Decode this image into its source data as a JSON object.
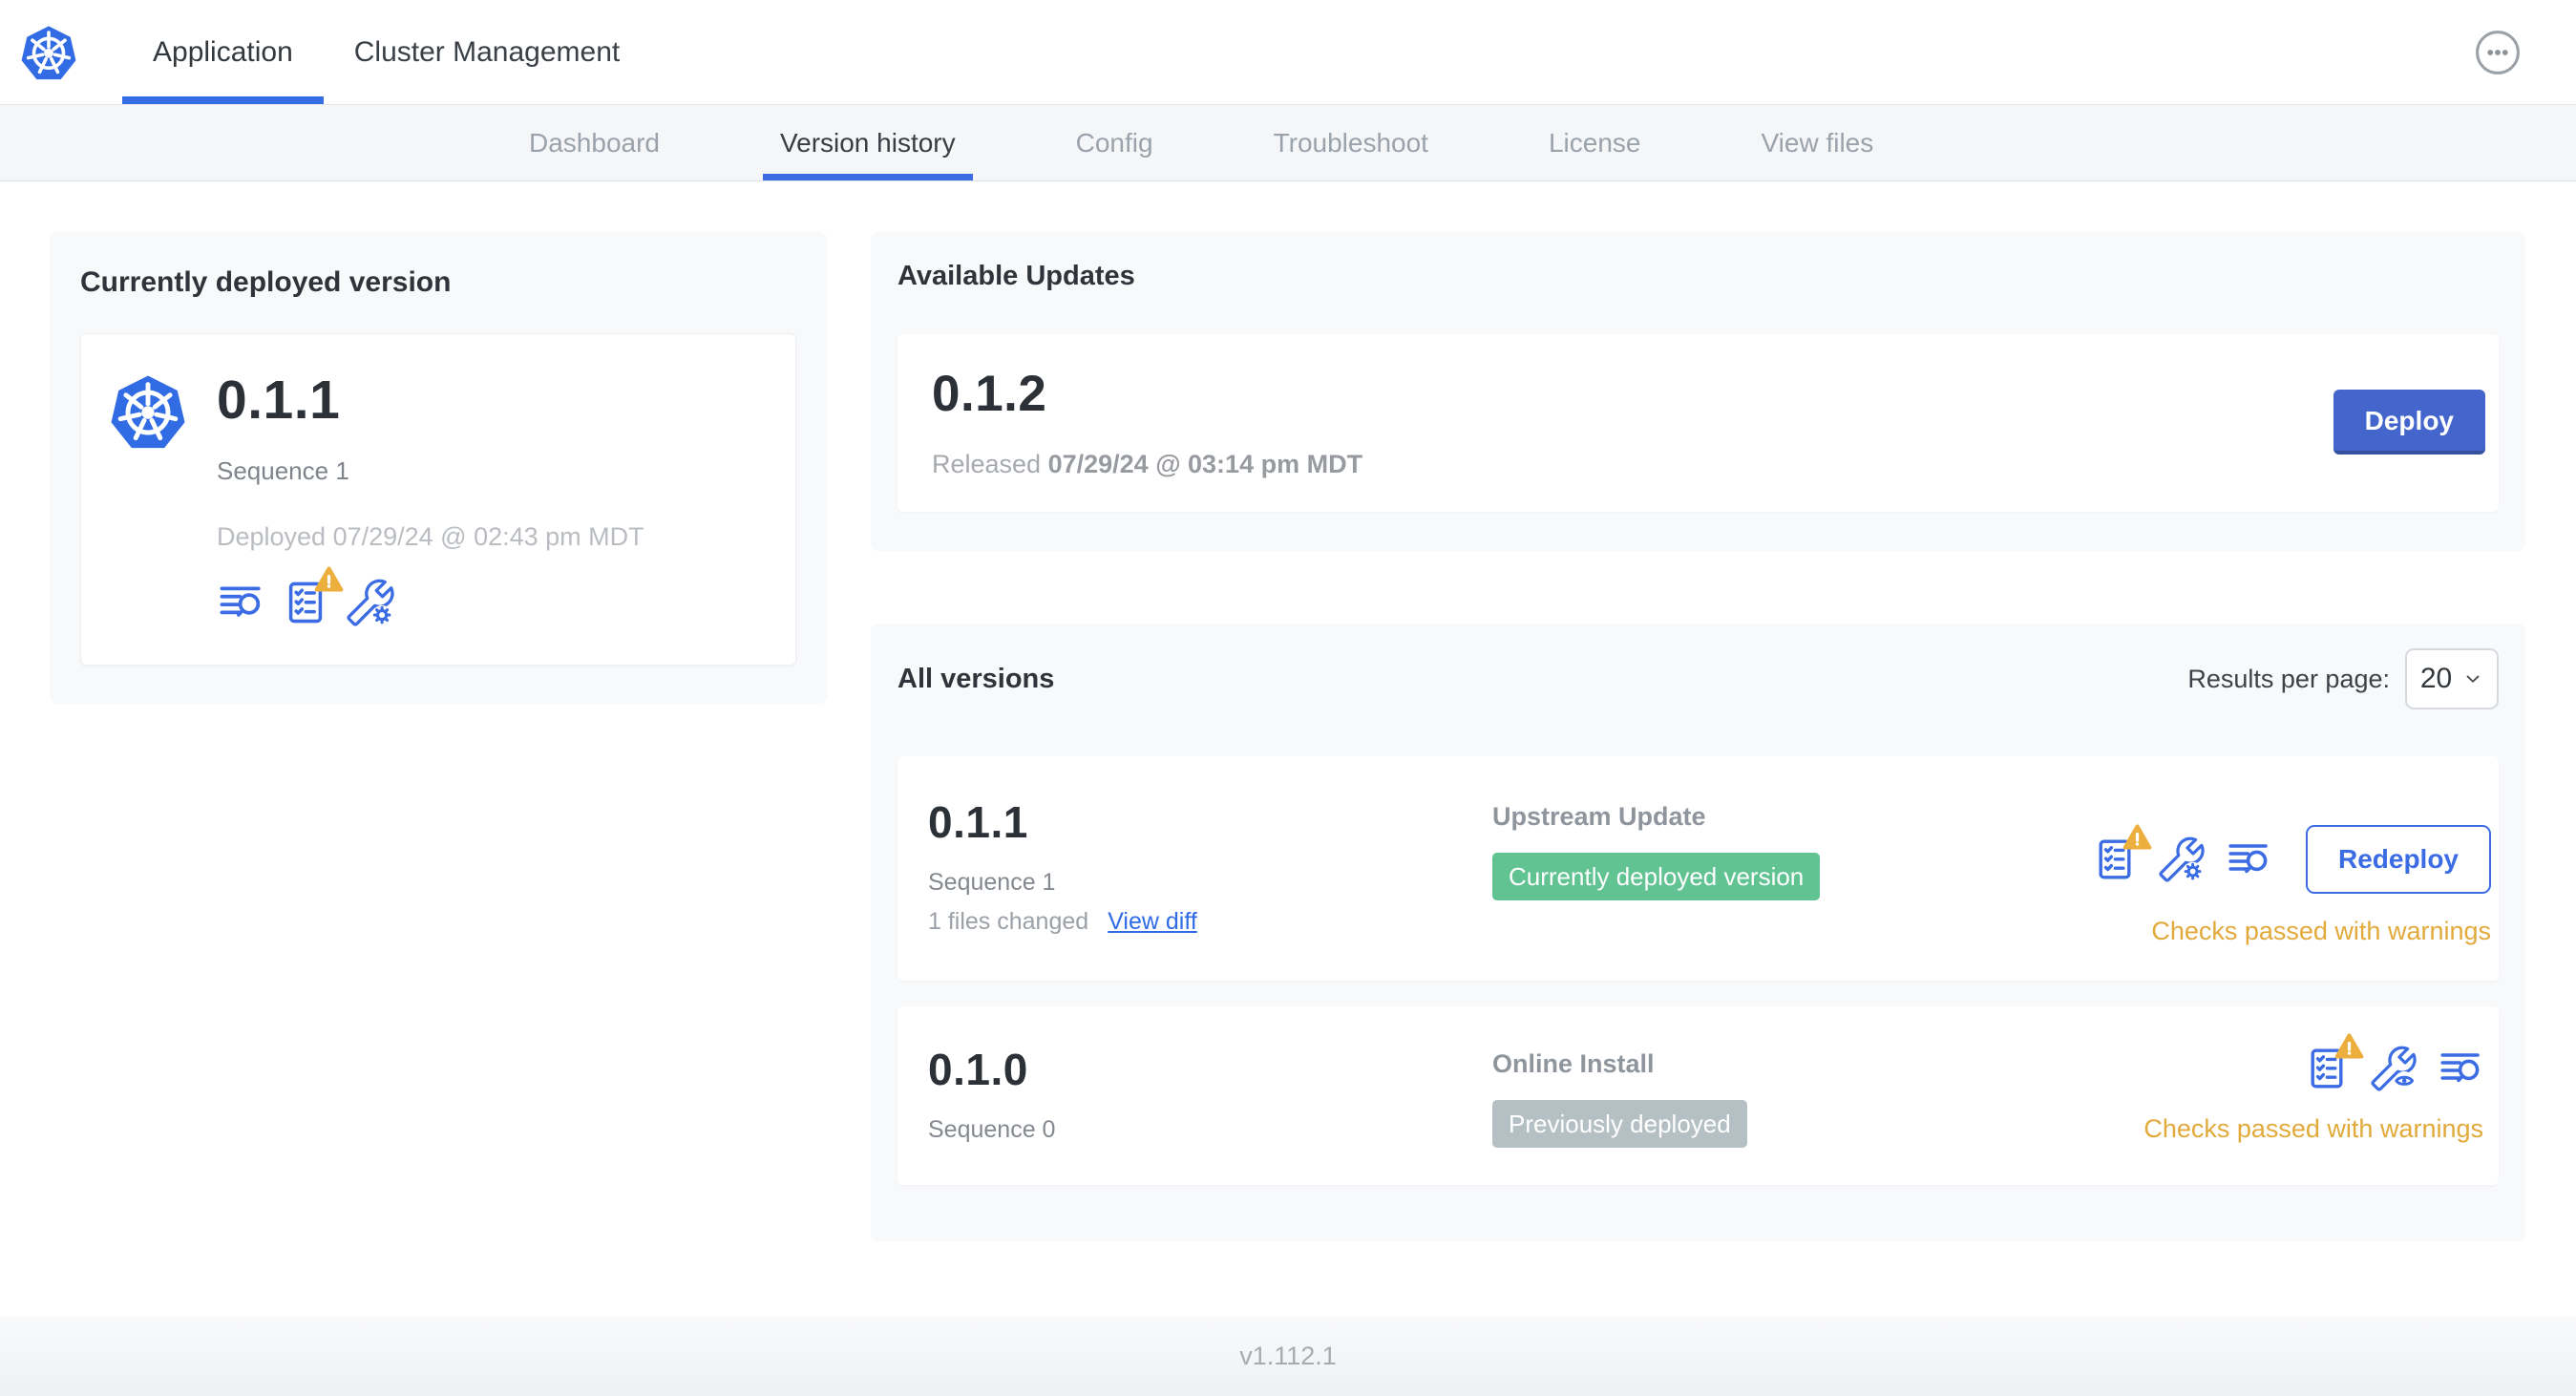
{
  "colors": {
    "accent_blue": "#326de6",
    "button_blue": "#4365cc",
    "link_blue": "#2f6be6",
    "warning_amber": "#e2a93b",
    "badge_green": "#61c392",
    "badge_gray": "#b5c0c4"
  },
  "topnav": {
    "tabs": [
      {
        "label": "Application",
        "active": true
      },
      {
        "label": "Cluster Management",
        "active": false
      }
    ],
    "overflow_menu_icon": "ellipsis-icon"
  },
  "subnav": {
    "items": [
      {
        "label": "Dashboard",
        "active": false
      },
      {
        "label": "Version history",
        "active": true
      },
      {
        "label": "Config",
        "active": false
      },
      {
        "label": "Troubleshoot",
        "active": false
      },
      {
        "label": "License",
        "active": false
      },
      {
        "label": "View files",
        "active": false
      }
    ]
  },
  "current": {
    "title": "Currently deployed version",
    "version": "0.1.1",
    "sequence": "Sequence 1",
    "deployed": "Deployed 07/29/24 @ 02:43 pm MDT",
    "icons": [
      "deploy-logs-icon",
      "preflight-checks-warning-icon",
      "edit-config-icon"
    ]
  },
  "updates": {
    "title": "Available Updates",
    "version": "0.1.2",
    "released_prefix": "Released",
    "released_date": "07/29/24 @ 03:14 pm MDT",
    "deploy_label": "Deploy"
  },
  "all_versions": {
    "title": "All versions",
    "results_per_page_label": "Results per page:",
    "results_per_page_value": "20",
    "rows": [
      {
        "version": "0.1.1",
        "sequence": "Sequence 1",
        "files_changed": "1 files changed",
        "view_diff_label": "View diff",
        "source": "Upstream Update",
        "badge": "Currently deployed version",
        "badge_color": "#61c392",
        "action_label": "Redeploy",
        "status": "Checks passed with warnings",
        "icons": [
          "preflight-checks-warning-icon",
          "edit-config-icon",
          "deploy-logs-icon"
        ]
      },
      {
        "version": "0.1.0",
        "sequence": "Sequence 0",
        "source": "Online Install",
        "badge": "Previously deployed",
        "badge_color": "#b5c0c4",
        "status": "Checks passed with warnings",
        "icons": [
          "preflight-checks-warning-icon",
          "view-config-icon",
          "deploy-logs-icon"
        ]
      }
    ]
  },
  "footer": {
    "version": "v1.112.1"
  }
}
